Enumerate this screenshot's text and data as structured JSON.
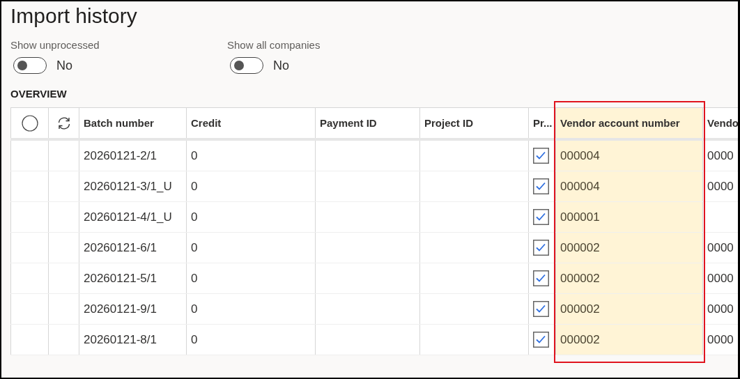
{
  "page": {
    "title": "Import history"
  },
  "filters": [
    {
      "label": "Show unprocessed",
      "on": false,
      "value": "No"
    },
    {
      "label": "Show all companies",
      "on": false,
      "value": "No"
    }
  ],
  "section": {
    "title": "OVERVIEW"
  },
  "table": {
    "columns": [
      {
        "kind": "select",
        "highlighted": false
      },
      {
        "kind": "refresh",
        "highlighted": false
      },
      {
        "kind": "text",
        "label": "Batch number",
        "highlighted": false
      },
      {
        "kind": "text",
        "label": "Credit",
        "highlighted": false
      },
      {
        "kind": "text",
        "label": "Payment ID",
        "highlighted": false
      },
      {
        "kind": "text",
        "label": "Project ID",
        "highlighted": false
      },
      {
        "kind": "check",
        "label": "Pr...",
        "highlighted": false
      },
      {
        "kind": "text",
        "label": "Vendor account number",
        "highlighted": true
      },
      {
        "kind": "text",
        "label": "Vendo",
        "highlighted": false
      }
    ],
    "rows": [
      {
        "batch_number": "20260121-2/1",
        "credit": "0",
        "processed": true,
        "vendor_account_number": "000004",
        "column_9": "0000"
      },
      {
        "batch_number": "20260121-3/1_U",
        "credit": "0",
        "processed": true,
        "vendor_account_number": "000004",
        "column_9": "0000"
      },
      {
        "batch_number": "20260121-4/1_U",
        "credit": "0",
        "processed": true,
        "vendor_account_number": "000001"
      },
      {
        "batch_number": "20260121-6/1",
        "credit": "0",
        "processed": true,
        "vendor_account_number": "000002",
        "column_9": "0000"
      },
      {
        "batch_number": "20260121-5/1",
        "credit": "0",
        "processed": true,
        "vendor_account_number": "000002",
        "column_9": "0000"
      },
      {
        "batch_number": "20260121-9/1",
        "credit": "0",
        "processed": true,
        "vendor_account_number": "000002",
        "column_9": "0000"
      },
      {
        "batch_number": "20260121-8/1",
        "credit": "0",
        "processed": true,
        "vendor_account_number": "000002",
        "column_9": "0000"
      }
    ]
  }
}
